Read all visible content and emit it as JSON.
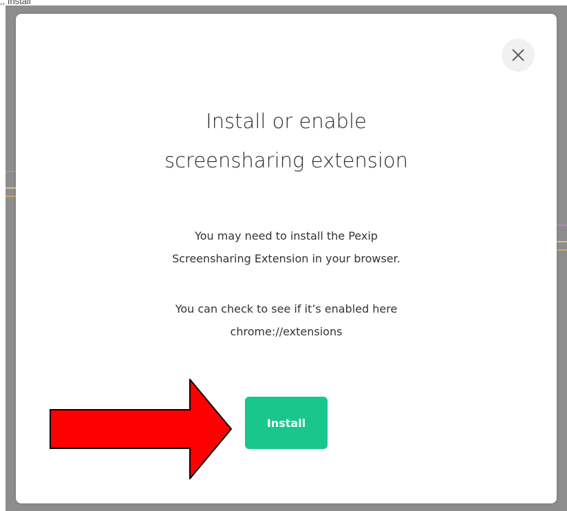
{
  "caption": ",, Install",
  "dialog": {
    "title_line1": "Install or enable",
    "title_line2": "screensharing extension",
    "message1_line1": "You may need to install the Pexip",
    "message1_line2": "Screensharing Extension in your browser.",
    "message2_line1": "You can check to see if it’s enabled here",
    "message2_line2": "chrome://extensions",
    "install_label": "Install",
    "close_icon": "close-icon"
  },
  "colors": {
    "backdrop": "#8d8d8d",
    "install_button": "#19c68c",
    "annotation_arrow": "#ff0000"
  }
}
